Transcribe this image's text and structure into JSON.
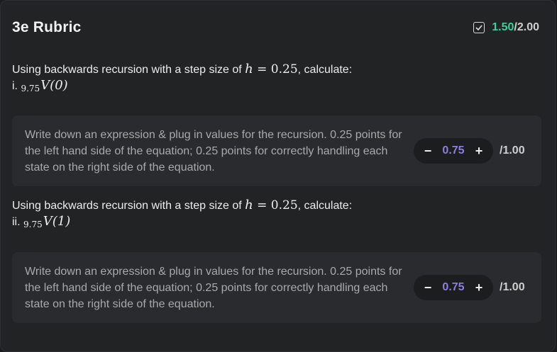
{
  "rubric": {
    "title": "3e Rubric",
    "total_earned": "1.50",
    "total_separator": "/",
    "total_possible": "2.00"
  },
  "questions": [
    {
      "prompt_before": "Using backwards recursion with a step size of ",
      "prompt_var": "h",
      "prompt_eq": " = ",
      "prompt_val": "0.25",
      "prompt_after": ", calculate:",
      "part_label": "i. ",
      "subscript": "9.75",
      "func": "V(0)",
      "criterion": "Write down an expression & plug in values for the recursion. 0.25 points for the left hand side of the equation; 0.25 points for correctly handling each state on the right side of the equation.",
      "decrement": "−",
      "score": "0.75",
      "increment": "+",
      "max": "/1.00"
    },
    {
      "prompt_before": "Using backwards recursion with a step size of ",
      "prompt_var": "h",
      "prompt_eq": " = ",
      "prompt_val": "0.25",
      "prompt_after": ", calculate:",
      "part_label": "ii. ",
      "subscript": "9.75",
      "func": "V(1)",
      "criterion": "Write down an expression & plug in values for the recursion. 0.25 points for the left hand side of the equation; 0.25 points for correctly handling each state on the right side of the equation.",
      "decrement": "−",
      "score": "0.75",
      "increment": "+",
      "max": "/1.00"
    }
  ],
  "colors": {
    "earned": "#3ecf9a",
    "score": "#8c7ee0",
    "panel": "#222325",
    "card": "#2a2b2e"
  },
  "icons": {
    "total": "checkbox-check-icon"
  }
}
